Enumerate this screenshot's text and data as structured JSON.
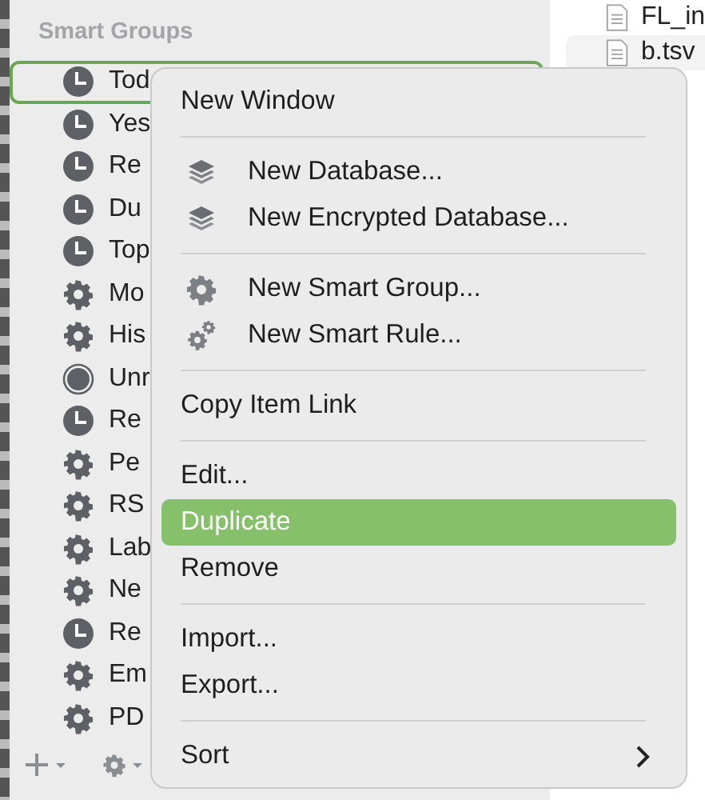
{
  "sidebar": {
    "heading": "Smart Groups",
    "items": [
      {
        "label": "Tod",
        "kind": "clock",
        "selected": true
      },
      {
        "label": "Yes",
        "kind": "clock",
        "selected": false
      },
      {
        "label": "Re",
        "kind": "clock",
        "selected": false
      },
      {
        "label": "Du",
        "kind": "clock",
        "selected": false
      },
      {
        "label": "Top",
        "kind": "clock",
        "selected": false
      },
      {
        "label": "Mo",
        "kind": "gear",
        "selected": false
      },
      {
        "label": "His",
        "kind": "gear",
        "selected": false
      },
      {
        "label": "Unr",
        "kind": "circle",
        "selected": false
      },
      {
        "label": "Re",
        "kind": "clock",
        "selected": false
      },
      {
        "label": "Pe",
        "kind": "gear",
        "selected": false
      },
      {
        "label": "RS",
        "kind": "gear",
        "selected": false
      },
      {
        "label": "Lab",
        "kind": "gear",
        "selected": false
      },
      {
        "label": "Ne",
        "kind": "gear",
        "selected": false
      },
      {
        "label": "Re",
        "kind": "clock",
        "selected": false
      },
      {
        "label": "Em",
        "kind": "gear",
        "selected": false
      },
      {
        "label": "PD",
        "kind": "gear",
        "selected": false
      }
    ]
  },
  "files": [
    {
      "name": "FL_in"
    },
    {
      "name": "b.tsv"
    }
  ],
  "context_menu": [
    {
      "kind": "plain",
      "label": "New Window",
      "selected": false
    },
    {
      "kind": "separator"
    },
    {
      "kind": "layers",
      "label": "New Database...",
      "selected": false
    },
    {
      "kind": "layers",
      "label": "New Encrypted Database...",
      "selected": false
    },
    {
      "kind": "separator"
    },
    {
      "kind": "gear",
      "label": "New Smart Group...",
      "selected": false
    },
    {
      "kind": "gears",
      "label": "New Smart Rule...",
      "selected": false
    },
    {
      "kind": "separator"
    },
    {
      "kind": "plain",
      "label": "Copy Item Link",
      "selected": false
    },
    {
      "kind": "separator"
    },
    {
      "kind": "plain",
      "label": "Edit...",
      "selected": false
    },
    {
      "kind": "plain",
      "label": "Duplicate",
      "selected": true
    },
    {
      "kind": "plain",
      "label": "Remove",
      "selected": false
    },
    {
      "kind": "separator"
    },
    {
      "kind": "plain",
      "label": "Import...",
      "selected": false
    },
    {
      "kind": "plain",
      "label": "Export...",
      "selected": false
    },
    {
      "kind": "separator"
    },
    {
      "kind": "submenu",
      "label": "Sort",
      "selected": false
    }
  ]
}
